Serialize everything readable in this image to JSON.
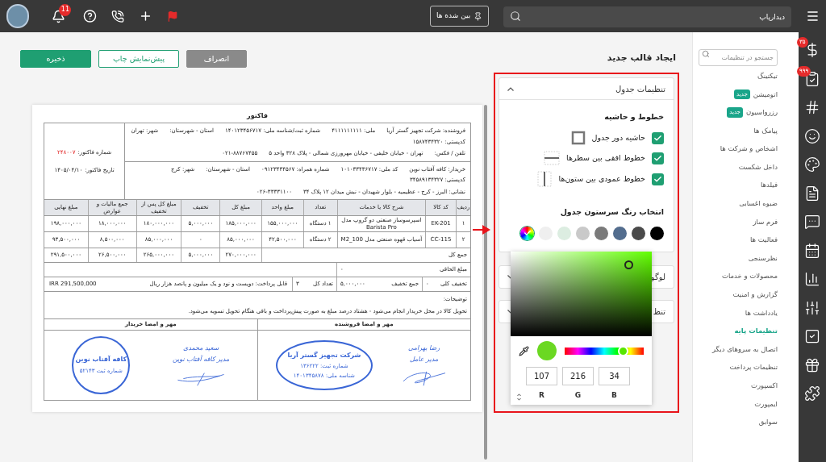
{
  "topbar": {
    "search": {
      "placeholder": "دیدارپاپ"
    },
    "pinned_button": "بین شده ها",
    "notification_badge": "11"
  },
  "header": {
    "title": "ایجاد قالب جدید",
    "buttons": [
      {
        "label": "انصراف",
        "kind": "muted"
      },
      {
        "label": "پیش‌نمایش چاپ",
        "kind": "outline"
      },
      {
        "label": "ذخیره",
        "kind": "primary"
      }
    ]
  },
  "invoice": {
    "title": "فاکتور",
    "parties": [
      {
        "lines": [
          [
            "فروشنده: شرکت تجهیز گستر آریا",
            "ملی: ۴۱۱۱۱۱۱۱۱۱",
            "شماره ثبت/شناسه ملی: ۱۴۰۱۲۳۴۵۶۷۱۷",
            "استان - شهرستان:",
            "شهر: تهران",
            "کدپستی: ۱۵۸۷۴۳۴۳۲۰"
          ],
          [
            "تلفن / فکس:",
            "تهران - خیابان خلیفی - خیابان مهرورزی شمالی - پلاک ۳۲۸ واحد ۵",
            "۰۲۱-۸۸۷۶۷۴۵۵"
          ]
        ]
      },
      {
        "lines": [
          [
            "خریدار: کافه آفتاب نوین",
            "کد ملی: ۱۰۱۰۳۳۴۳۶۷۱۷",
            "شماره همراه: ۰۹۱۲۳۴۳۴۵۶۷",
            "استان - شهرستان:",
            "شهر: کرج",
            "کدپستی: ۳۴۵۸۹۱۳۴۳۲۷"
          ],
          [
            "نشانی: البرز - کرج - عظیمیه - بلوار شهیدان - نبش میدان ۱۲ پلاک ۳۴",
            "۰۲۶-۳۳۳۳۱۱۰۰"
          ]
        ]
      }
    ],
    "meta": [
      {
        "label": "شماره فاکتور:",
        "value": "۲۴۸۰۰۷",
        "highlight": true
      },
      {
        "label": "تاریخ فاکتور:",
        "value": "۱۴۰۵/۰۴/۱۰",
        "highlight": false
      }
    ],
    "columns": [
      "ردیف",
      "کد کالا",
      "شرح کالا یا خدمات",
      "تعداد",
      "مبلغ واحد",
      "مبلغ کل",
      "تخفیف",
      "مبلغ کل پس از تخفیف",
      "جمع مالیات و عوارض",
      "مبلغ نهایی"
    ],
    "rows": [
      [
        "۱",
        "EK-201",
        "اسپرسوساز صنعتی دو گروپ مدل Barista Pro",
        "۱ دستگاه",
        "۱۵۵,۰۰۰,۰۰۰",
        "۱۸۵,۰۰۰,۰۰۰",
        "۵,۰۰۰,۰۰۰",
        "۱۸۰,۰۰۰,۰۰۰",
        "۱۸,۰۰۰,۰۰۰",
        "۱۹۸,۰۰۰,۰۰۰"
      ],
      [
        "۲",
        "CC-115",
        "آسیاب قهوه صنعتی مدل M2_100",
        "۲ دستگاه",
        "۴۲,۵۰۰,۰۰۰",
        "۸۵,۰۰۰,۰۰۰",
        "۰",
        "۸۵,۰۰۰,۰۰۰",
        "۸,۵۰۰,۰۰۰",
        "۹۳,۵۰۰,۰۰۰"
      ]
    ],
    "total_row": {
      "label": "جمع کل",
      "values": [
        "۲۷۰,۰۰۰,۰۰۰",
        "۵,۰۰۰,۰۰۰",
        "۲۶۵,۰۰۰,۰۰۰",
        "۲۶,۵۰۰,۰۰۰",
        "۲۹۱,۵۰۰,۰۰۰"
      ]
    },
    "extra": {
      "label": "مبلغ الحاقی",
      "value": "۰"
    },
    "summary": [
      {
        "label": "تخفیف کلی",
        "value": "۰"
      },
      {
        "label": "جمع تخفیف",
        "value": "۵,۰۰۰,۰۰۰"
      },
      {
        "label": "تعداد کل",
        "value": "۳"
      }
    ],
    "payable_label": "قابل پرداخت: دویست و نود و یک میلیون و پانصد هزار ریال",
    "payable_amount": "IRR 291,500,000",
    "notes_label": "توضیحات:",
    "notes": "تحویل کالا در محل خریدار انجام می‌شود - هشتاد درصد مبلغ به صورت پیش‌پرداخت و باقی هنگام تحویل تسویه می‌شود.",
    "signatures": [
      {
        "heading": "مهر و امضا فروشنده",
        "signer": [
          "رضا بهرامی",
          "مدیر عامل"
        ],
        "stamp": {
          "kind": "oval",
          "lines": [
            "شرکت تجهیز گستر آریا",
            "شماره ثبت: ۱۳۶۲۲۲",
            "شناسه ملی: ۱۴۰۱۳۴۵۸۷۸"
          ]
        }
      },
      {
        "heading": "مهر و امضا خریدار",
        "signer": [
          "سعید محمدی",
          "مدیر کافه آفتاب نوین"
        ],
        "stamp": {
          "kind": "round",
          "lines": [
            "کافه آفتاب نوین",
            "شماره ثبت ۵۲۱۴۳"
          ]
        }
      }
    ]
  },
  "panel": {
    "accordions": [
      {
        "title": "تنظیمات جدول",
        "expanded": true
      },
      {
        "title": "لوگو",
        "expanded": false
      },
      {
        "title": "تنظ",
        "expanded": false
      }
    ],
    "section_title": "خطوط و حاشیه",
    "options": [
      {
        "label": "حاشیه دور جدول",
        "checked": true,
        "kind": "outer-border"
      },
      {
        "label": "خطوط افقی بین سطرها",
        "checked": true,
        "kind": "horizontal-lines"
      },
      {
        "label": "خطوط عمودی بین ستون‌ها",
        "checked": true,
        "kind": "vertical-lines"
      }
    ],
    "color_title": "انتخاب رنگ سرستون جدول",
    "swatches": [
      {
        "kind": "swatch",
        "color": "#000000",
        "selected": false
      },
      {
        "kind": "swatch",
        "color": "#4a4a4a",
        "selected": false
      },
      {
        "kind": "swatch",
        "color": "#536d8e",
        "selected": false
      },
      {
        "kind": "swatch",
        "color": "#7a7a7a",
        "selected": false
      },
      {
        "kind": "swatch",
        "color": "#c9c9c9",
        "selected": false
      },
      {
        "kind": "swatch",
        "color": "#dcede1",
        "selected": false
      },
      {
        "kind": "swatch",
        "color": "#efefef",
        "selected": false
      },
      {
        "kind": "custom",
        "selected": true
      }
    ],
    "picker": {
      "hue": {
        "level": 0.73
      },
      "channels": [
        {
          "label": "B",
          "value": "34"
        },
        {
          "label": "G",
          "value": "216"
        },
        {
          "label": "R",
          "value": "107"
        }
      ]
    }
  },
  "sidebar": {
    "search": {
      "placeholder": "جستجو در تنظیمات"
    },
    "items": [
      {
        "label": "تیکتینگ",
        "selected": false
      },
      {
        "label": "اتومیشن",
        "badge": "جدید",
        "selected": false
      },
      {
        "label": "رزرواسیون",
        "badge": "جدید",
        "selected": false
      },
      {
        "label": "پیامک ها",
        "selected": false
      },
      {
        "label": "اشخاص و شرکت ها",
        "selected": false
      },
      {
        "label": "داخل شکست",
        "selected": false
      },
      {
        "label": "فیلدها",
        "selected": false
      },
      {
        "label": "ضبوه اغسابی",
        "selected": false
      },
      {
        "label": "فرم ساز",
        "selected": false
      },
      {
        "label": "فعالیت ها",
        "selected": false
      },
      {
        "label": "نظرسنجی",
        "selected": false
      },
      {
        "label": "محصولات و خدمات",
        "selected": false
      },
      {
        "label": "گزارش و امنیت",
        "selected": false
      },
      {
        "label": "یادداشت ها",
        "selected": false
      },
      {
        "label": "تنظیمات پایه",
        "selected": true
      },
      {
        "label": "اتصال به سروهای دیگر",
        "selected": false
      },
      {
        "label": "تنظیمات پرداخت",
        "selected": false
      },
      {
        "label": "اکسپورت",
        "selected": false
      },
      {
        "label": "ایمپورت",
        "selected": false
      },
      {
        "label": "سوابق",
        "selected": false
      }
    ]
  },
  "rail": [
    {
      "kind": "dollar",
      "badge": "۳۵"
    },
    {
      "kind": "clipboard",
      "badge": "۹۹۹"
    },
    {
      "kind": "hash"
    },
    {
      "kind": "smile"
    },
    {
      "kind": "palette"
    },
    {
      "kind": "document"
    },
    {
      "kind": "chat"
    },
    {
      "kind": "calendar"
    },
    {
      "kind": "chart"
    },
    {
      "kind": "sliders"
    },
    {
      "kind": "check"
    },
    {
      "kind": "gift"
    },
    {
      "kind": "puzzle"
    }
  ]
}
